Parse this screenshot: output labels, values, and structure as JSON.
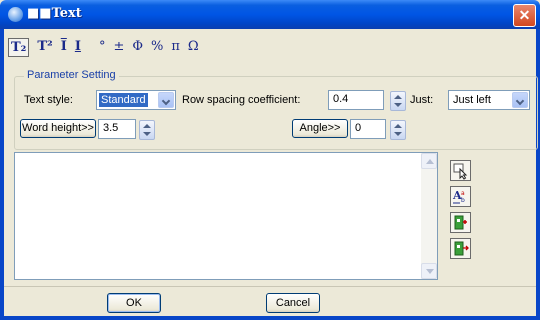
{
  "window": {
    "title": "Text",
    "title_prefix_glyph": "■■",
    "close_glyph": "✕"
  },
  "toolbar": {
    "items": [
      {
        "label": "T₂",
        "name": "subscript"
      },
      {
        "label": "T²",
        "name": "superscript"
      },
      {
        "label": "I",
        "name": "overline"
      },
      {
        "label": "I",
        "name": "underline"
      },
      {
        "label": "°",
        "name": "degree"
      },
      {
        "label": "±",
        "name": "plus-minus"
      },
      {
        "label": "Φ",
        "name": "diameter"
      },
      {
        "label": "%",
        "name": "percent"
      },
      {
        "label": "π",
        "name": "pi"
      },
      {
        "label": "Ω",
        "name": "omega"
      }
    ]
  },
  "parameters": {
    "legend": "Parameter Setting",
    "text_style_label": "Text style:",
    "text_style_value": "Standard",
    "row_spacing_label": "Row spacing coefficient:",
    "row_spacing_value": "0.4",
    "just_label": "Just:",
    "just_value": "Just left",
    "word_height_button": "Word height>>",
    "word_height_value": "3.5",
    "angle_button": "Angle>>",
    "angle_value": "0"
  },
  "editor": {
    "value": ""
  },
  "side_buttons": [
    {
      "name": "pick-text-icon"
    },
    {
      "name": "text-format-icon"
    },
    {
      "name": "insert-symbol-icon"
    },
    {
      "name": "insert-field-icon"
    }
  ],
  "footer": {
    "ok_label": "OK",
    "cancel_label": "Cancel"
  },
  "colors": {
    "titlebar": "#0055e5",
    "close": "#d2471e",
    "legend": "#1a40a8",
    "selection": "#316ac5"
  }
}
